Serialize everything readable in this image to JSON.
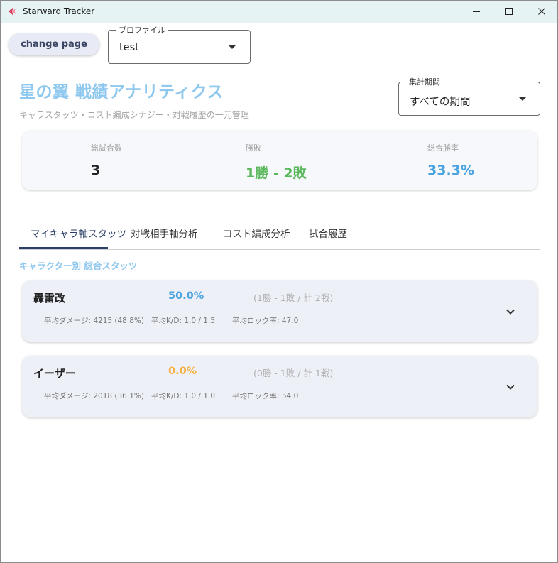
{
  "window": {
    "title": "Starward Tracker"
  },
  "toolbar": {
    "change_page_label": "change page"
  },
  "profile_select": {
    "legend": "プロファイル",
    "value": "test"
  },
  "period_select": {
    "legend": "集計期間",
    "value": "すべての期間"
  },
  "header": {
    "title": "星の翼 戦績アナリティクス",
    "subtitle": "キャラスタッツ・コスト編成シナジー・対戦履歴の一元管理"
  },
  "summary": {
    "total_matches_label": "総試合数",
    "total_matches_value": "3",
    "record_label": "勝敗",
    "record_value": "1勝 - 2敗",
    "win_rate_label": "総合勝率",
    "win_rate_value": "33.3%"
  },
  "tabs": [
    {
      "label": "マイキャラ軸スタッツ"
    },
    {
      "label": "対戦相手軸分析"
    },
    {
      "label": "コスト編成分析"
    },
    {
      "label": "試合履歴"
    }
  ],
  "section_heading": "キャラクター別 総合スタッツ",
  "characters": [
    {
      "name": "轟雷改",
      "win_rate": "50.0%",
      "record": "(1勝 - 1敗 / 計 2戦)",
      "avg_damage": "平均ダメージ: 4215 (48.8%)",
      "avg_kd": "平均K/D: 1.0 / 1.5",
      "avg_lock": "平均ロック率: 47.0"
    },
    {
      "name": "イーザー",
      "win_rate": "0.0%",
      "record": "(0勝 - 1敗 / 計 1戦)",
      "avg_damage": "平均ダメージ: 2018 (36.1%)",
      "avg_kd": "平均K/D: 1.0 / 1.0",
      "avg_lock": "平均ロック率: 54.0"
    }
  ],
  "colors": {
    "title_accent": "#8fc8ee",
    "win_green": "#5cb85c",
    "rate_blue": "#4aa3df",
    "rate_orange": "#f5b041",
    "tab_active": "#2c3e66"
  }
}
